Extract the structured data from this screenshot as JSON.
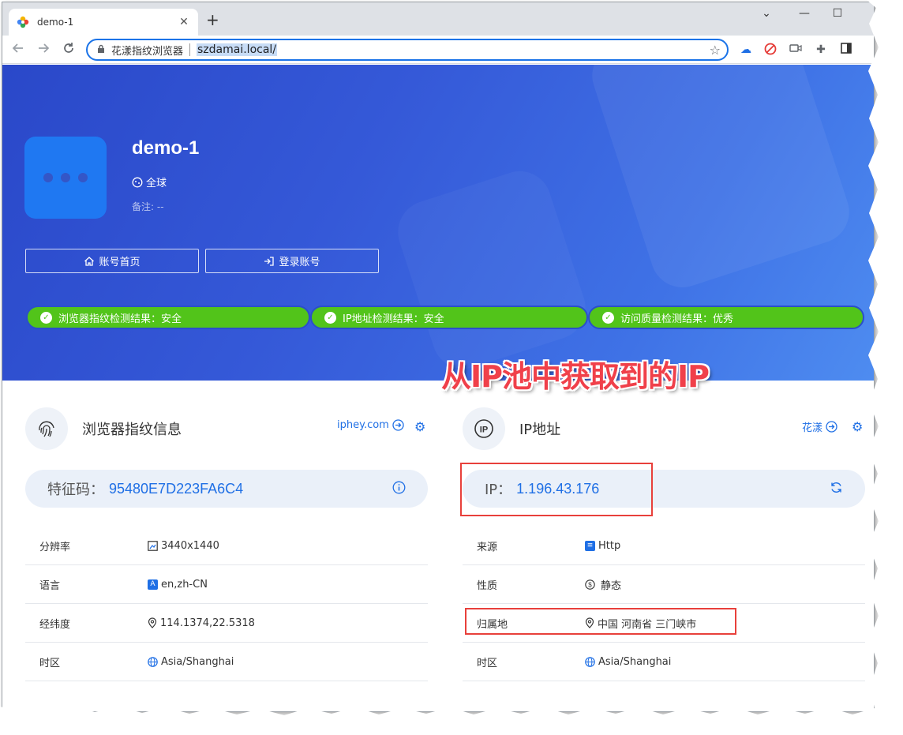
{
  "browser": {
    "tab_title": "demo-1",
    "tab_close": "✕",
    "new_tab": "+",
    "window_controls": [
      "⌄",
      "—",
      "☐"
    ],
    "omnibox_label": "花漾指纹浏览器",
    "url": "szdamai.local/",
    "icons": [
      "back-icon",
      "forward-icon",
      "reload-icon",
      "lock-icon",
      "star-icon",
      "cloud-extension-icon",
      "block-icon",
      "camera-icon",
      "puzzle-icon",
      "sidebar-icon"
    ]
  },
  "profile": {
    "name": "demo-1",
    "region": "全球",
    "note": "备注: --",
    "buttons": {
      "home": "账号首页",
      "login": "登录账号"
    }
  },
  "status": {
    "fingerprint": "浏览器指纹检测结果：安全",
    "ip": "IP地址检测结果：安全",
    "quality": "访问质量检测结果：优秀"
  },
  "annotation": "从IP池中获取到的IP",
  "fingerprint_card": {
    "title": "浏览器指纹信息",
    "link": "iphey.com",
    "key_label": "特征码：",
    "key_value": "95480E7D223FA6C4",
    "rows": [
      {
        "label": "分辨率",
        "value": "3440x1440"
      },
      {
        "label": "语言",
        "value": "en,zh-CN"
      },
      {
        "label": "经纬度",
        "value": "114.1374,22.5318"
      },
      {
        "label": "时区",
        "value": "Asia/Shanghai"
      }
    ]
  },
  "ip_card": {
    "title": "IP地址",
    "link": "花漾",
    "key_label": "IP：",
    "key_value": "1.196.43.176",
    "rows": [
      {
        "label": "来源",
        "value": "Http"
      },
      {
        "label": "性质",
        "value": "静态"
      },
      {
        "label": "归属地",
        "value": "中国 河南省 三门峡市"
      },
      {
        "label": "时区",
        "value": "Asia/Shanghai"
      }
    ]
  },
  "colors": {
    "accent": "#1f6fe5",
    "status_green": "#52c41a",
    "highlight_red": "#e8403b"
  }
}
